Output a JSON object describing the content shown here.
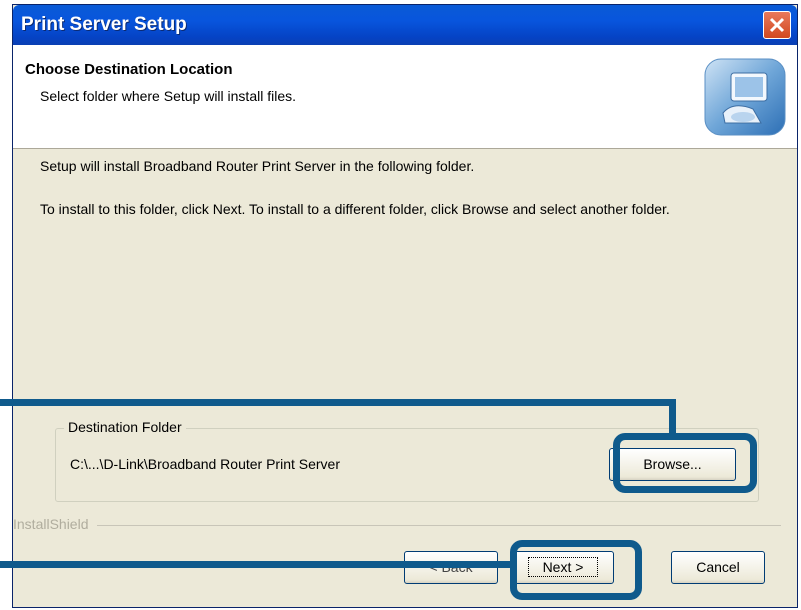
{
  "window": {
    "title": "Print Server Setup"
  },
  "header": {
    "title": "Choose Destination Location",
    "subtitle": "Select folder where Setup will install files.",
    "icon": "setup-computer-icon"
  },
  "content": {
    "line1": "Setup will install Broadband Router Print Server in the following folder.",
    "line2": "To install to this folder, click Next. To install to a different folder, click Browse and select another folder."
  },
  "destination": {
    "group_label": "Destination Folder",
    "path": "C:\\...\\D-Link\\Broadband Router Print Server",
    "browse_label": "Browse..."
  },
  "footer": {
    "brand": "InstallShield",
    "back_label": "< Back",
    "next_label": "Next >",
    "cancel_label": "Cancel"
  },
  "colors": {
    "title_bar": "#0a5bd6",
    "dialog_bg": "#ece9d8",
    "callout": "#0f5a8c",
    "close_button": "#d24920"
  }
}
